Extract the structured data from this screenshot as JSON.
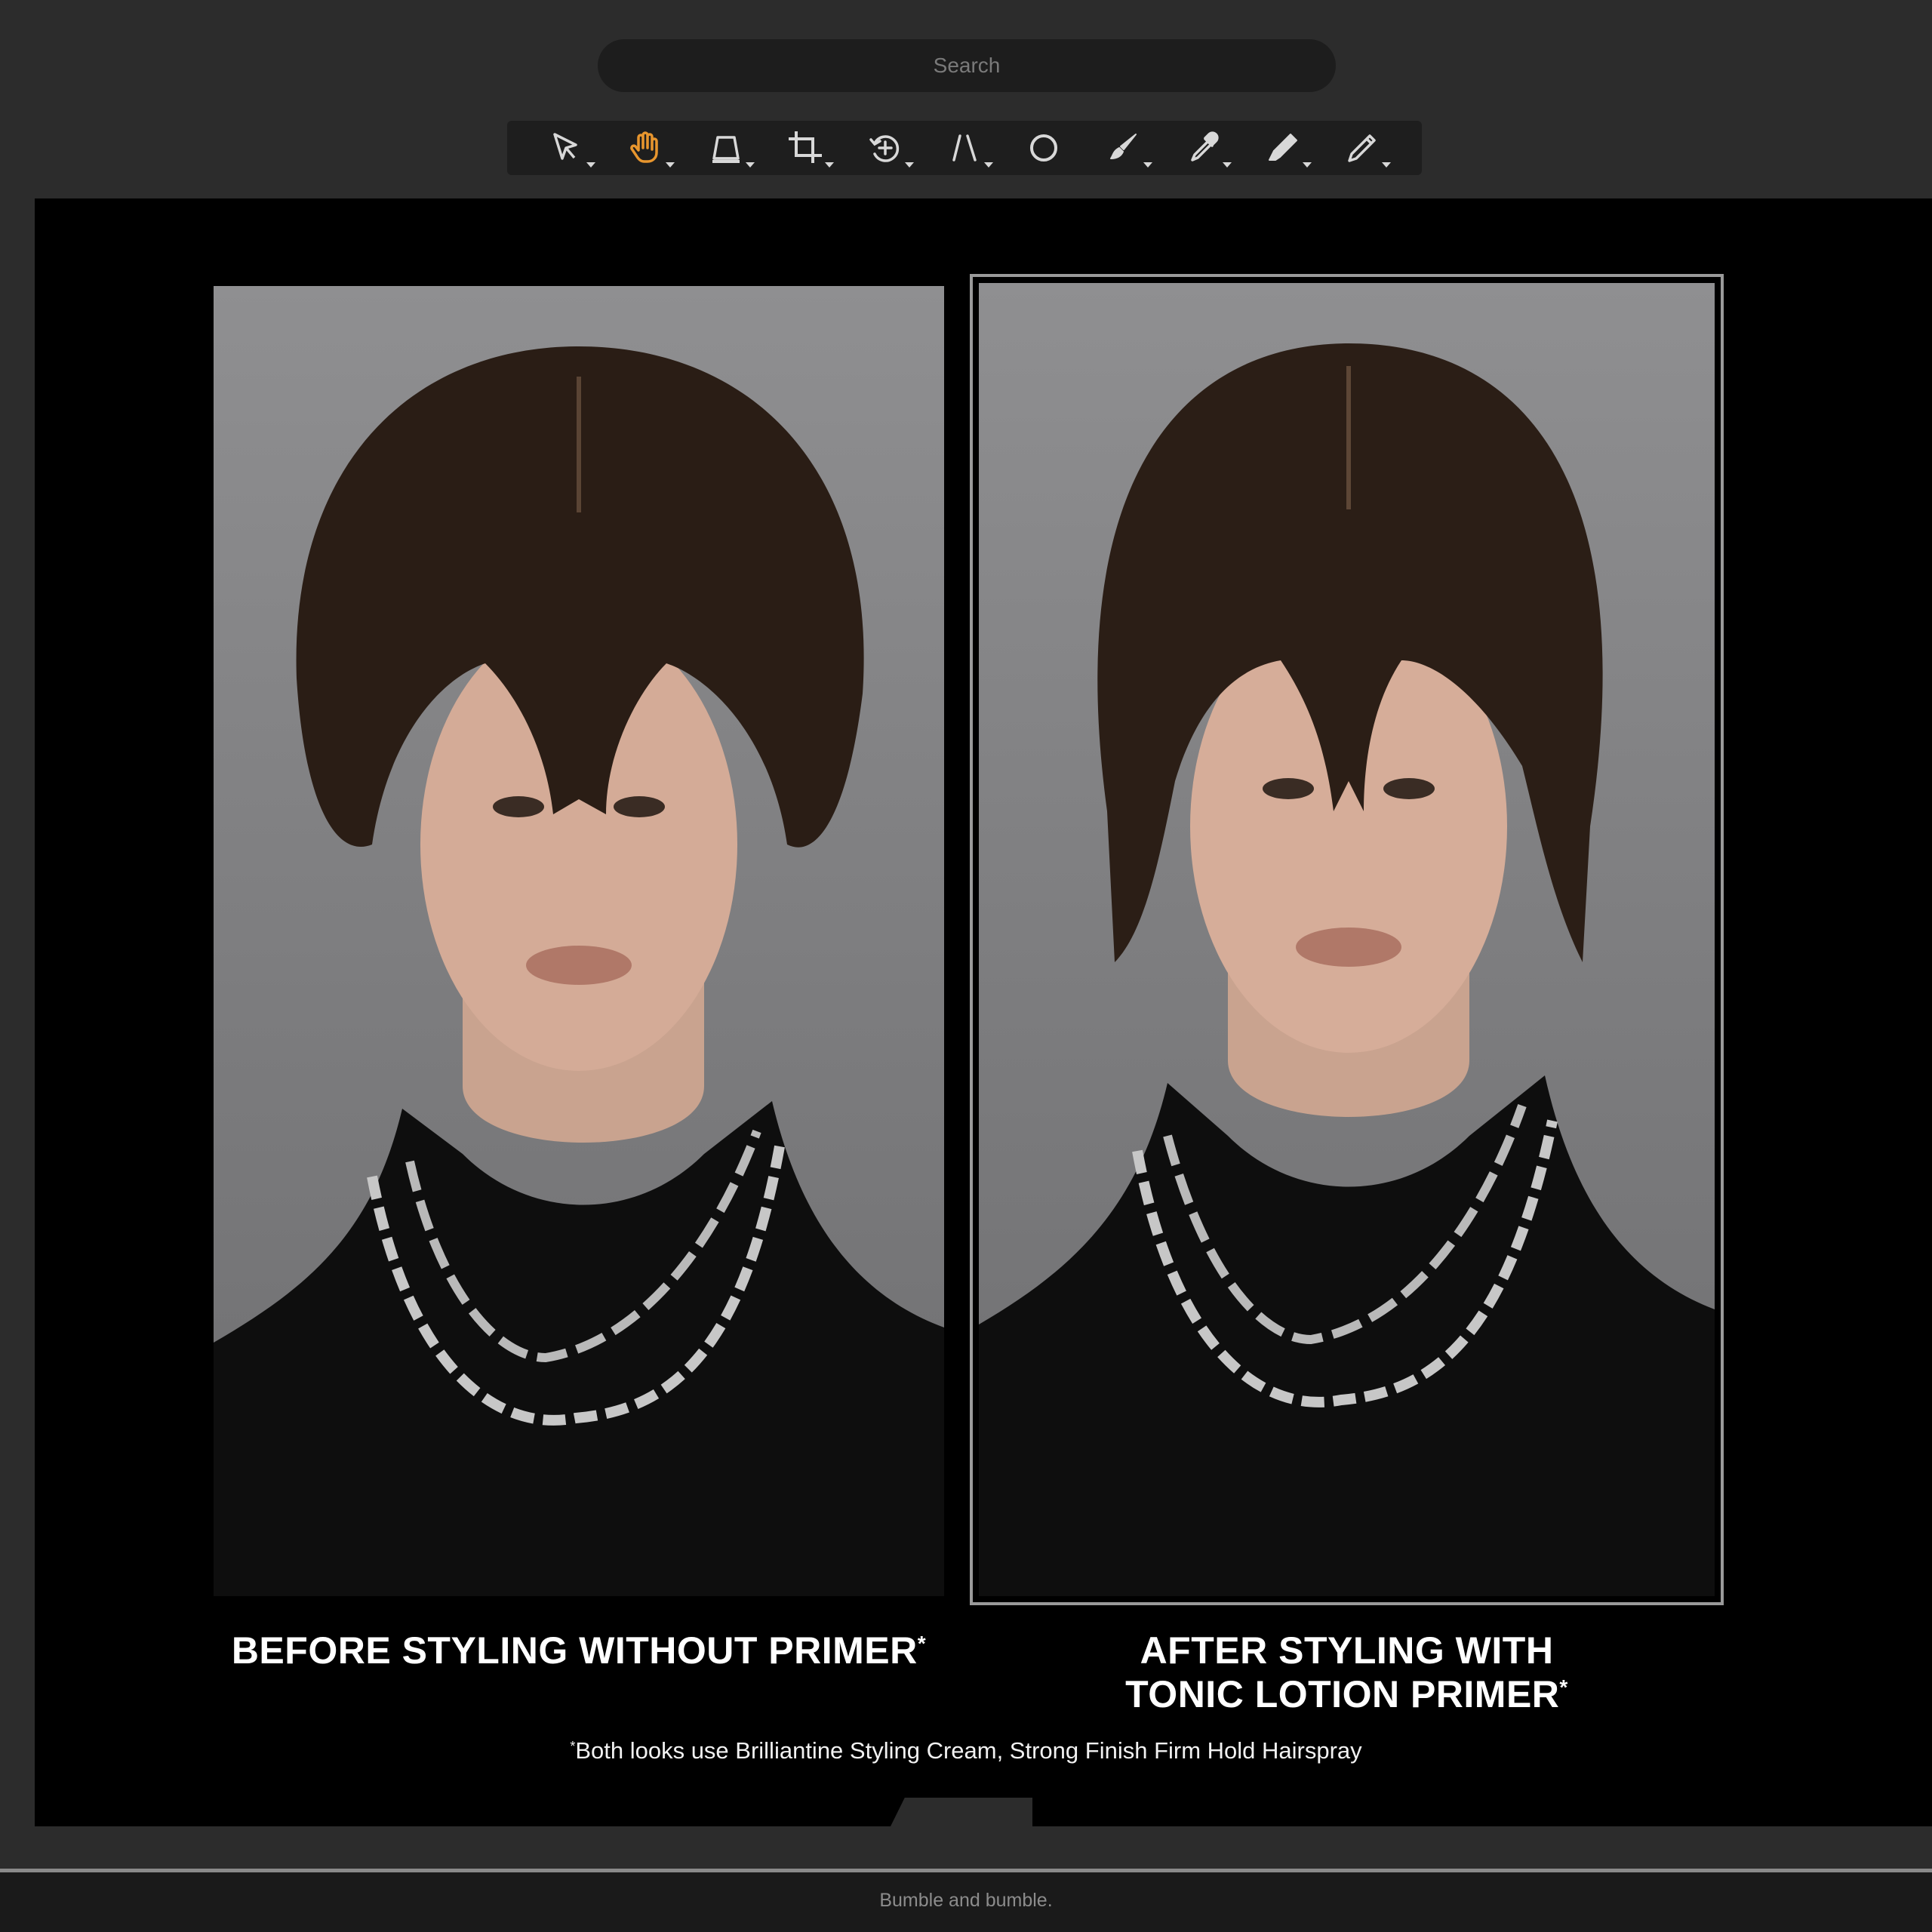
{
  "search": {
    "placeholder": "Search"
  },
  "toolbar": {
    "tools": [
      {
        "name": "select-tool",
        "icon": "arrow-pointer-icon",
        "active": false
      },
      {
        "name": "hand-tool",
        "icon": "hand-icon",
        "active": true
      },
      {
        "name": "perspective-tool",
        "icon": "perspective-icon",
        "active": false
      },
      {
        "name": "crop-tool",
        "icon": "crop-icon",
        "active": false
      },
      {
        "name": "rotate-tool",
        "icon": "rotate-icon",
        "active": false
      },
      {
        "name": "straighten-tool",
        "icon": "straighten-icon",
        "active": false
      },
      {
        "name": "shape-tool",
        "icon": "circle-icon",
        "active": false
      },
      {
        "name": "brush-tool",
        "icon": "brush-icon",
        "active": false
      },
      {
        "name": "eyedropper-tool",
        "icon": "eyedropper-icon",
        "active": false
      },
      {
        "name": "eraser-tool",
        "icon": "eraser-icon",
        "active": false
      },
      {
        "name": "pen-tool",
        "icon": "pen-icon",
        "active": false
      }
    ],
    "active_color": "#e8962e",
    "icon_color": "#d8d8d8"
  },
  "document": {
    "before_caption": "BEFORE STYLING WITHOUT PRIMER",
    "before_mark": "*",
    "after_caption_line1": "AFTER STYLING WITH",
    "after_caption_line2": "TONIC LOTION PRIMER",
    "after_mark": "*",
    "footnote_mark": "*",
    "footnote": "Both looks use Brilliantine Styling Cream, Strong Finish Firm Hold Hairspray"
  },
  "status": {
    "brand": "Bumble and bumble."
  }
}
